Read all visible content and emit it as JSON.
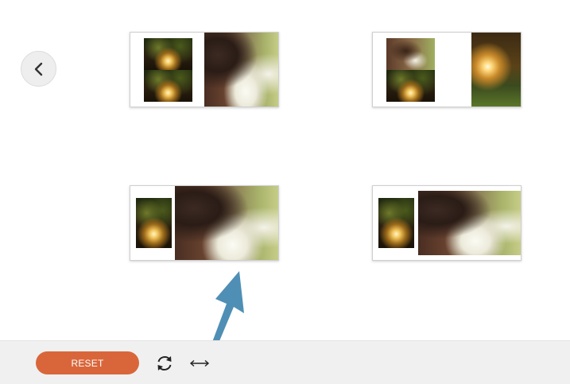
{
  "toolbar": {
    "reset_label": "RESET",
    "reset_color": "#d9663a",
    "background": "#f0f0f0",
    "refresh_icon": "refresh-icon",
    "swap_icon": "horizontal-arrows-icon"
  },
  "navigation": {
    "back_icon": "chevron-left-icon"
  },
  "spreads": [
    {
      "layout": "two-stacked-left-large-right"
    },
    {
      "layout": "two-stacked-left-large-right-alt"
    },
    {
      "layout": "single-left-wide-right"
    },
    {
      "layout": "single-left-wide-right-alt"
    }
  ],
  "annotation": {
    "arrow_color": "#4f8fb5"
  }
}
